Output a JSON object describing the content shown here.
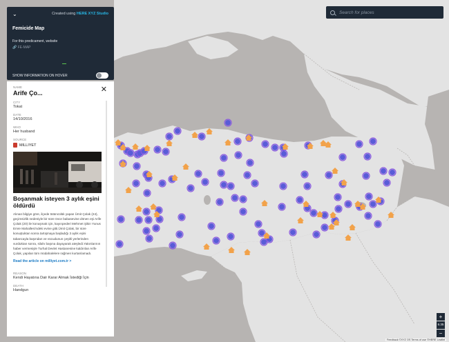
{
  "app": {
    "created_using_prefix": "Created using",
    "created_using_brand": "HERE XYZ Studio",
    "title": "Femicide Map",
    "description": "For this predicament, website",
    "source_line": "FE-MAP",
    "hover_toggle_label": "SHOW INFORMATION ON HOVER",
    "hover_toggle_on": false
  },
  "search": {
    "placeholder": "Search for places"
  },
  "detail": {
    "name_label": "NAME",
    "name": "Arife Ço...",
    "city_label": "CITY",
    "city": "Tokat",
    "date_label": "DATE",
    "date": "14/10/2016",
    "who_label": "WHO",
    "who": "Her husband",
    "source_label": "SOURCE",
    "source": "MILLIYET",
    "headline": "Boşanmak isteyen 3 aylık eşini öldürdü",
    "body": "Alınan bilgiye göre, ilçede tütüncülük yapan Ümit Çolak (24), geçimsizlik nedeniyle bir süre önce babasevine dönen eşi Arife Çolak (20) ile konuşmak için, kayınpederi Mehmet Şikin Yunus Emre Mahallesi'ndeki evine gitti.Ümit Çolak, bir süre konuştuktan sonra tartışmaya başladığı 3 aylık eşini tabancayla başından ve vücudunun çeşitli yerlerinden vurduktan sonra, silahı başına dayayarak ateşledi.Yakınlarının haber vermesiyle Turhal Devlet Hastanesine kaldırılan Arife Çolak, yapılan tüm müdahalelere rağmen kurtarılamadı.",
    "link": "Read the article on milliyet.com.tr >",
    "reason_label": "REASON",
    "reason": "Kendi Hayatına Dair Karar Almak İstediği İçin",
    "death_label": "DEATH",
    "death": "Handgun"
  },
  "map": {
    "zoom_level": "6.35",
    "attribution": "Feedback  ©XYZ OS  Terms of use  ©HERE  Leaflet",
    "colors": {
      "sea": "#b7b4b2",
      "land": "#e3e3e3",
      "land_dark": "#d4d2d0",
      "murder": "#5a5bd8",
      "murder_ring": "#8a58e0",
      "house": "#f2a24a"
    }
  }
}
